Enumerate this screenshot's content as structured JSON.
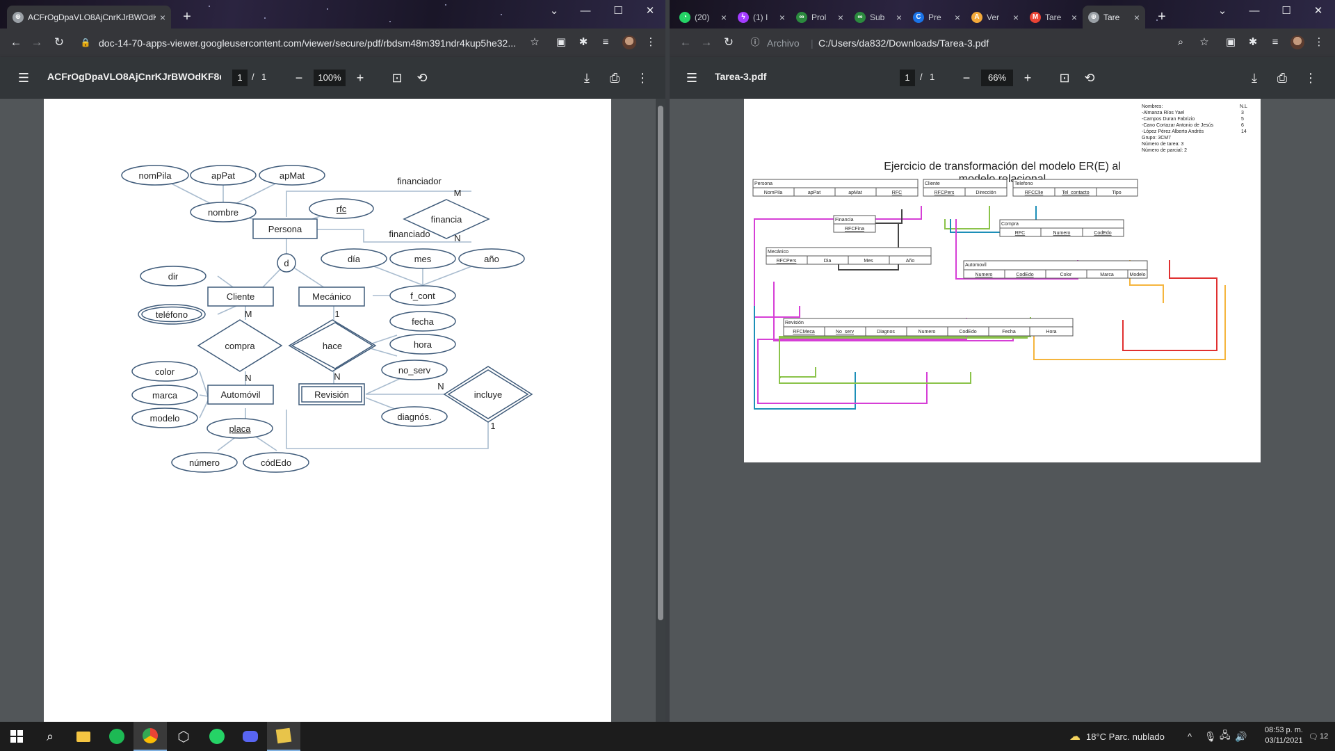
{
  "left_window": {
    "tab": {
      "title": "ACFrOgDpaVLO8AjCnrKJrBWOdKF8q",
      "close": "×"
    },
    "new_tab": "+",
    "url": "doc-14-70-apps-viewer.googleusercontent.com/viewer/secure/pdf/rbdsm48m391ndr4kup5he32...",
    "pdf": {
      "title": "ACFrOgDpaVLO8AjCnrKJrBWOdKF8q...",
      "page": "1",
      "page_sep": "/",
      "total_pages": "1",
      "zoom": "100%"
    }
  },
  "right_window": {
    "tabs": [
      {
        "label": "(20)",
        "icon": "whatsapp-icon",
        "color": "#25d366"
      },
      {
        "label": "(1) I",
        "icon": "messenger-icon",
        "color": "#a33bff"
      },
      {
        "label": "Prol",
        "icon": "pln-icon",
        "color": "#2b8a3e"
      },
      {
        "label": "Sub",
        "icon": "pln-icon",
        "color": "#2b8a3e"
      },
      {
        "label": "Pre",
        "icon": "circle-icon",
        "color": "#1a73e8"
      },
      {
        "label": "Ver",
        "icon": "af-icon",
        "color": "#f4a93a"
      },
      {
        "label": "Tare",
        "icon": "gmail-icon",
        "color": "#ea4335"
      },
      {
        "label": "Tare",
        "icon": "chrome-icon",
        "color": "#9aa0a6"
      }
    ],
    "tab_close": "×",
    "new_tab": "+",
    "url_prefix": "Archivo",
    "url": "C:/Users/da832/Downloads/Tarea-3.pdf",
    "pdf": {
      "title": "Tarea-3.pdf",
      "page": "1",
      "page_sep": "/",
      "total_pages": "1",
      "zoom": "66%"
    }
  },
  "er_diagram": {
    "attributes": [
      "nomPila",
      "apPat",
      "apMat",
      "nombre",
      "rfc",
      "día",
      "mes",
      "año",
      "dir",
      "teléfono",
      "f_cont",
      "fecha",
      "hora",
      "no_serv",
      "diagnós.",
      "color",
      "marca",
      "modelo",
      "placa",
      "número",
      "códEdo"
    ],
    "entities": [
      "Persona",
      "Cliente",
      "Mecánico",
      "Automóvil",
      "Revisión"
    ],
    "relationships": [
      "financia",
      "compra",
      "hace",
      "incluye"
    ],
    "disjoint": "d",
    "role_labels": [
      "financiador",
      "financiado"
    ],
    "cardinalities": {
      "financia_top": "M",
      "financia_bottom": "N",
      "compra_top": "M",
      "compra_bottom": "N",
      "hace_top": "1",
      "hace_bottom": "N",
      "incluye_left": "N",
      "incluye_bottom": "1"
    }
  },
  "relational_doc": {
    "heading": [
      "Nombres:",
      "N.L"
    ],
    "names": [
      {
        "name": "-Almanza Ríos Yael",
        "nl": "3"
      },
      {
        "name": "-Campos Duran Fabrizio",
        "nl": "5"
      },
      {
        "name": "-Cano Cortazar Antonio de Jesús",
        "nl": "6"
      },
      {
        "name": "-López Pérez Alberto Andrés",
        "nl": "14"
      }
    ],
    "info": [
      "Grupo: 3CM7",
      "Número de tarea: 3",
      "Número de parcial: 2"
    ],
    "title_lines": [
      "Ejercicio de transformación del modelo ER(E) al",
      "modelo relacional"
    ],
    "tables": [
      {
        "name": "Persona",
        "cols": [
          "NomPila",
          "apPat",
          "apMat",
          "RFC"
        ]
      },
      {
        "name": "Cliente",
        "cols": [
          "RFCPers",
          "Dirección"
        ]
      },
      {
        "name": "Telefono",
        "cols": [
          "RFCClie",
          "Tel_contacto",
          "Tipo"
        ]
      },
      {
        "name": "Financia",
        "cols": [
          "RFCFina"
        ]
      },
      {
        "name": "Compra",
        "cols": [
          "RFC",
          "Numero",
          "CodEdo"
        ]
      },
      {
        "name": "Mecánico",
        "cols": [
          "RFCPers",
          "Dia",
          "Mes",
          "Año"
        ]
      },
      {
        "name": "Automovil",
        "cols": [
          "Numero",
          "CodEdo",
          "Color",
          "Marca",
          "Modelo"
        ]
      },
      {
        "name": "Revisión",
        "cols": [
          "RFCMeca",
          "No_serv",
          "Diagnos",
          "Numero",
          "CodEdo",
          "Fecha",
          "Hora"
        ]
      }
    ]
  },
  "taskbar": {
    "weather": "18°C  Parc. nublado",
    "tray_chevron": "^",
    "time": "08:53 p. m.",
    "date": "03/11/2021",
    "notifications": "12"
  },
  "colors": {
    "pdf_toolbar": "#323639",
    "viewer_bg": "#525659",
    "diagram_stroke": "#3f5b7a",
    "fk_magenta": "#d63fd6",
    "fk_green": "#8bc34a",
    "fk_teal": "#1c8fb8",
    "fk_red": "#e03030",
    "fk_orange": "#f5b53d",
    "fk_dark": "#444444"
  }
}
